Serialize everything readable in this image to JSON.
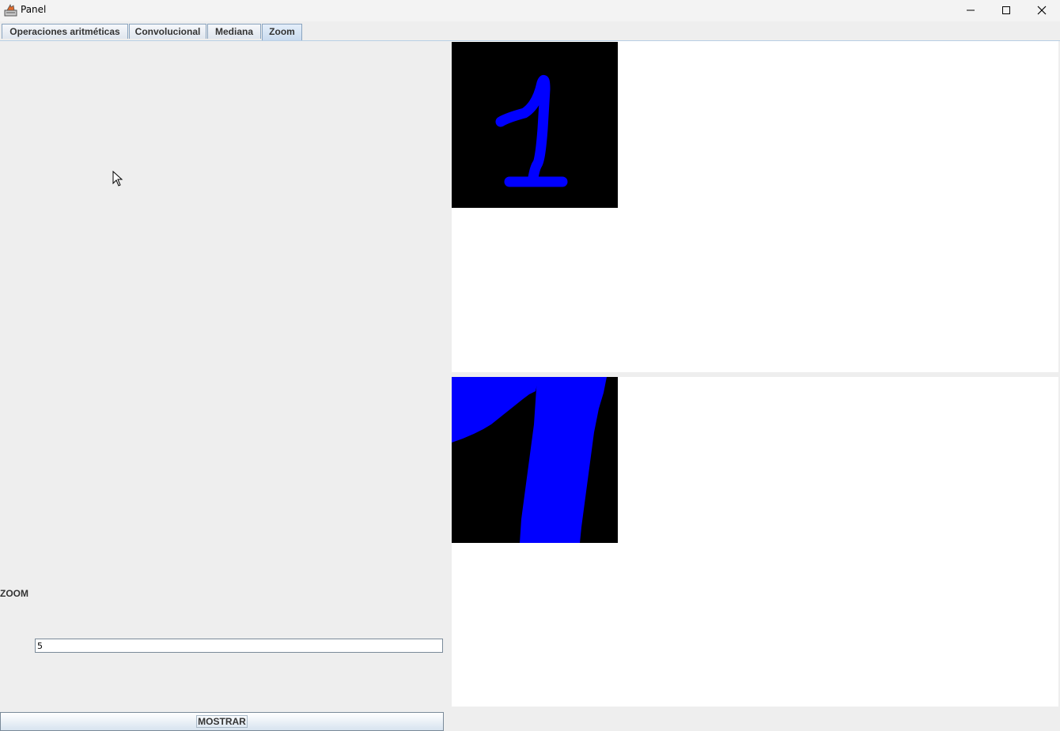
{
  "window": {
    "title": "Panel",
    "app_icon": "java-icon",
    "controls": [
      "minimize-icon",
      "maximize-icon",
      "close-icon"
    ]
  },
  "tabs": [
    {
      "label": "Operaciones aritméticas",
      "active": false
    },
    {
      "label": "Convolucional",
      "active": false
    },
    {
      "label": "Mediana",
      "active": false
    },
    {
      "label": "Zoom",
      "active": true
    }
  ],
  "left_panel": {
    "zoom_label": "ZOOM",
    "zoom_value": "5",
    "show_button": "MOSTRAR"
  },
  "images": {
    "original": {
      "content": "1",
      "background": "#000000",
      "stroke_color": "#0000ff"
    },
    "zoomed": {
      "background": "#000000",
      "stroke_color": "#0000ff"
    }
  },
  "colors": {
    "panel_bg": "#eeeeee",
    "canvas_bg": "#ffffff",
    "tab_border": "#8aa4bf"
  }
}
